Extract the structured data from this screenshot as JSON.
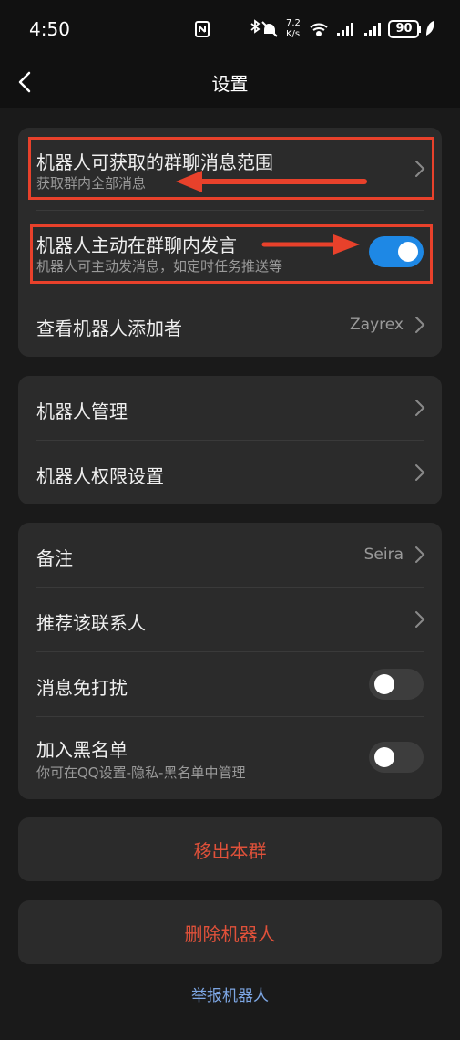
{
  "status_bar": {
    "time": "4:50",
    "net_speed_value": "7.2",
    "net_speed_unit": "K/s",
    "battery": "90"
  },
  "header": {
    "title": "设置"
  },
  "card1": {
    "group_msg_scope": {
      "title": "机器人可获取的群聊消息范围",
      "subtitle": "获取群内全部消息"
    },
    "proactive_speech": {
      "title": "机器人主动在群聊内发言",
      "subtitle": "机器人可主动发消息，如定时任务推送等",
      "enabled": true
    },
    "view_adder": {
      "title": "查看机器人添加者",
      "value": "Zayrex"
    }
  },
  "card2": {
    "bot_manage": {
      "title": "机器人管理"
    },
    "bot_permissions": {
      "title": "机器人权限设置"
    }
  },
  "card3": {
    "remark": {
      "title": "备注",
      "value": "Seira"
    },
    "recommend": {
      "title": "推荐该联系人"
    },
    "dnd": {
      "title": "消息免打扰",
      "enabled": false
    },
    "blacklist": {
      "title": "加入黑名单",
      "subtitle": "你可在QQ设置-隐私-黑名单中管理",
      "enabled": false
    }
  },
  "actions": {
    "remove_from_group": "移出本群",
    "delete_bot": "删除机器人",
    "report": "举报机器人"
  },
  "colors": {
    "accent_red": "#e8412b",
    "toggle_on": "#1e88e5",
    "danger_text": "#e0513a",
    "link_blue": "#7da6e3"
  }
}
